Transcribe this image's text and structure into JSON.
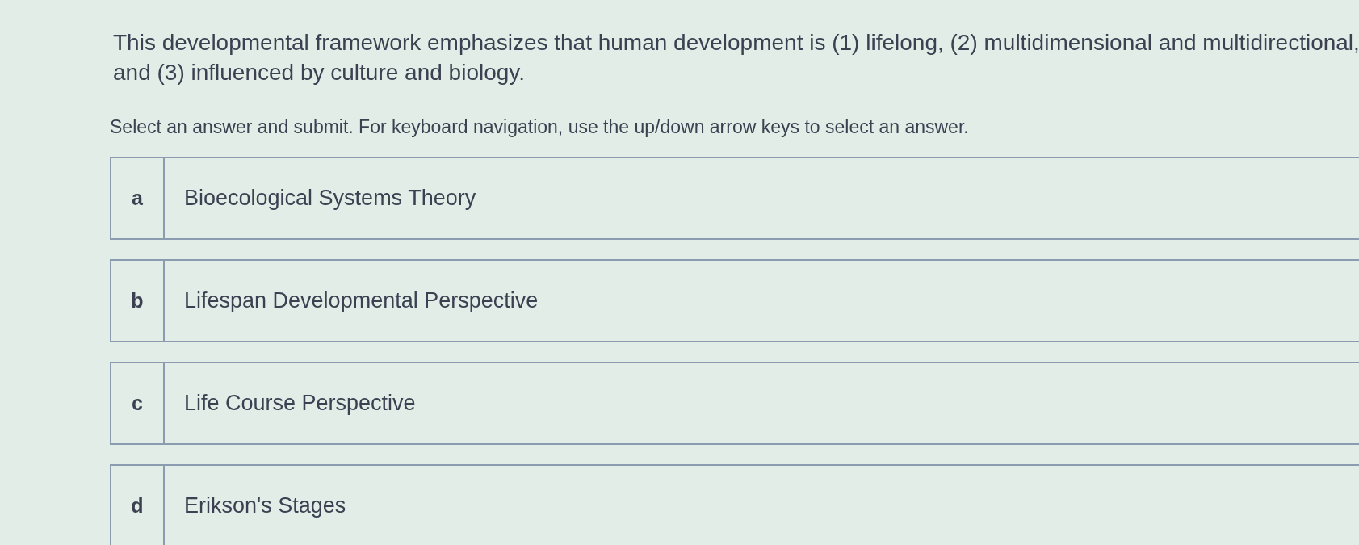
{
  "question": {
    "text": "This developmental framework emphasizes that human development is (1) lifelong, (2) multidimensional and multidirectional, and (3) influenced by culture and biology."
  },
  "instruction": "Select an answer and submit. For keyboard navigation, use the up/down arrow keys to select an answer.",
  "options": [
    {
      "letter": "a",
      "label": "Bioecological Systems Theory",
      "selected": false
    },
    {
      "letter": "b",
      "label": "Lifespan Developmental Perspective",
      "selected": false
    },
    {
      "letter": "c",
      "label": "Life Course Perspective",
      "selected": false
    },
    {
      "letter": "d",
      "label": "Erikson's Stages",
      "selected": false
    }
  ]
}
